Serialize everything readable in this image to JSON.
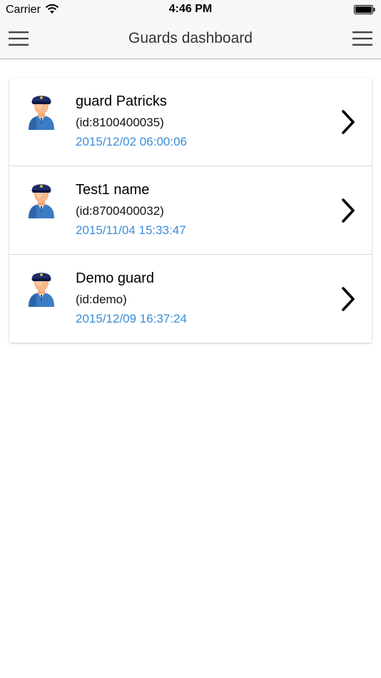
{
  "status_bar": {
    "carrier": "Carrier",
    "time": "4:46 PM"
  },
  "nav": {
    "title": "Guards dashboard",
    "left_icon": "hamburger-menu-icon",
    "right_icon": "hamburger-menu-icon"
  },
  "guards": [
    {
      "name": "guard Patricks",
      "id": "(id:8100400035)",
      "time": "2015/12/02 06:00:06"
    },
    {
      "name": "Test1 name",
      "id": "(id:8700400032)",
      "time": "2015/11/04 15:33:47"
    },
    {
      "name": "Demo guard",
      "id": "(id:demo)",
      "time": "2015/12/09 16:37:24"
    }
  ],
  "colors": {
    "accent_time": "#3b8cdc",
    "nav_background": "#f7f7f7"
  }
}
